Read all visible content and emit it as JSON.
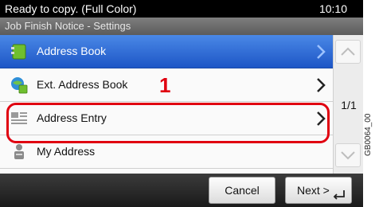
{
  "status": {
    "message": "Ready to copy. (Full Color)",
    "time": "10:10"
  },
  "title": "Job Finish Notice - Settings",
  "items": [
    {
      "label": "Address Book",
      "icon": "address-book-icon"
    },
    {
      "label": "Ext. Address Book",
      "icon": "ext-address-book-icon"
    },
    {
      "label": "Address Entry",
      "icon": "address-entry-icon"
    },
    {
      "label": "My Address",
      "icon": "my-address-icon"
    }
  ],
  "annotation": {
    "step": "1",
    "color": "#e00010"
  },
  "page_indicator": "1/1",
  "buttons": {
    "cancel": "Cancel",
    "next": "Next >"
  },
  "side_code": "GB0064_00",
  "colors": {
    "selected": "#2a63d4",
    "highlight": "#e00010"
  }
}
